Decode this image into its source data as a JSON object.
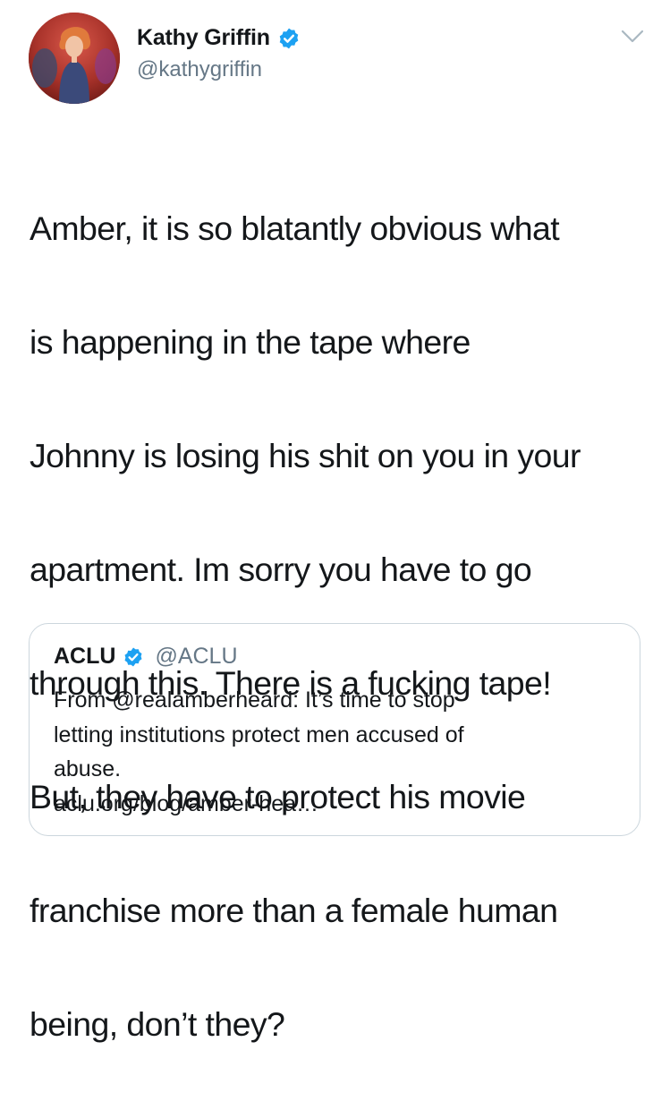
{
  "tweet": {
    "author": {
      "display_name": "Kathy Griffin",
      "handle": "@kathygriffin",
      "verified": true,
      "avatar_icon": "profile-photo"
    },
    "menu_icon": "chevron-down-icon",
    "text_lines": [
      "Amber, it is so blatantly obvious what",
      "is happening in the tape where",
      "Johnny is losing his shit on you in your",
      "apartment. Im sorry you have to go",
      "through this. There is a fucking tape!",
      "But, they have to protect his movie",
      "franchise more than a female human",
      "being, don’t they?"
    ]
  },
  "quoted_tweet": {
    "display_name": "ACLU",
    "handle": "@ACLU",
    "verified": true,
    "text_lines": [
      "From @realamberheard: It’s time to stop",
      "letting institutions protect men accused of",
      "abuse."
    ],
    "link": "aclu.org/blog/amber-hea…"
  },
  "colors": {
    "text": "#14171a",
    "secondary": "#657786",
    "verified_badge": "#1da1f2",
    "border": "#ccd6dd"
  }
}
